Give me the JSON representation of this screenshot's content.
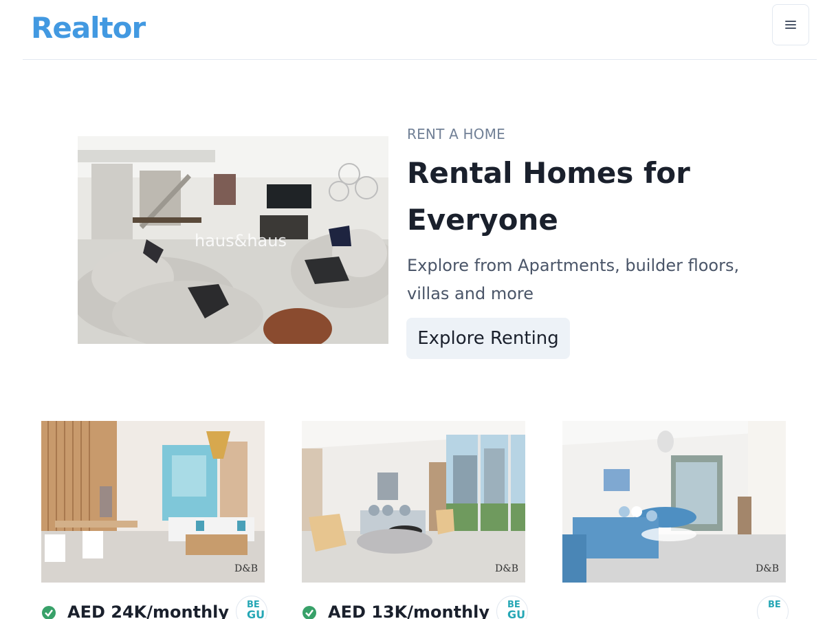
{
  "header": {
    "logo": "Realtor",
    "menu_icon": "hamburger-menu-icon"
  },
  "hero": {
    "eyebrow": "RENT A HOME",
    "title": "Rental Homes for Everyone",
    "description": "Explore from Apartments, builder floors, villas and more",
    "button_label": "Explore Renting",
    "image_watermark": "haus&haus"
  },
  "listings": [
    {
      "price": "AED 24K/monthly",
      "verified": true,
      "badge_text": "BE",
      "badge_text2": "GU",
      "watermark": "D&B"
    },
    {
      "price": "AED 13K/monthly",
      "verified": true,
      "badge_text": "BE",
      "badge_text2": "GU",
      "watermark": "D&B"
    },
    {
      "price": "",
      "verified": false,
      "badge_text": "BE",
      "badge_text2": "",
      "watermark": "D&B"
    }
  ],
  "colors": {
    "brand": "#4299e1",
    "verified": "#38a169",
    "badge": "#26a7b5"
  }
}
